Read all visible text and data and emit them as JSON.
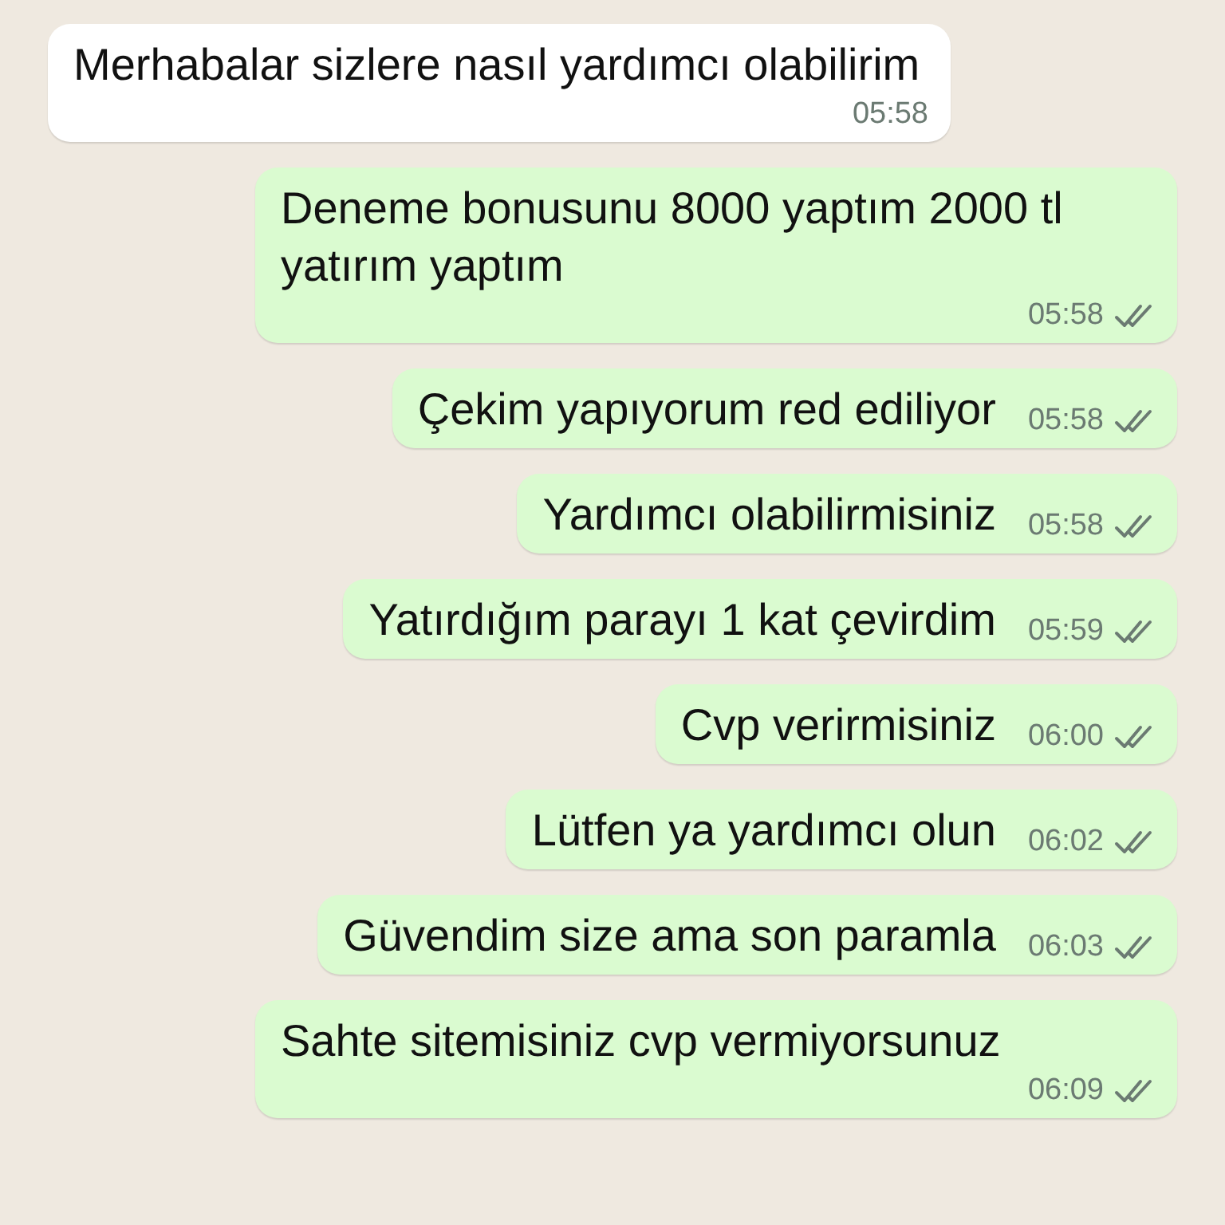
{
  "messages": [
    {
      "kind": "incoming",
      "text": "Merhabalar sizlere nasıl yardımcı olabilirim",
      "time": "05:58"
    },
    {
      "kind": "outgoing",
      "text": "Deneme bonusunu 8000 yaptım 2000 tl yatırım yaptım",
      "time": "05:58",
      "read": false
    },
    {
      "kind": "outgoing",
      "text": "Çekim yapıyorum red ediliyor",
      "time": "05:58",
      "read": false
    },
    {
      "kind": "outgoing",
      "text": "Yardımcı olabilirmisiniz",
      "time": "05:58",
      "read": false
    },
    {
      "kind": "outgoing",
      "text": "Yatırdığım parayı 1 kat çevirdim",
      "time": "05:59",
      "read": false
    },
    {
      "kind": "outgoing",
      "text": "Cvp verirmisiniz",
      "time": "06:00",
      "read": false
    },
    {
      "kind": "outgoing",
      "text": "Lütfen ya yardımcı olun",
      "time": "06:02",
      "read": false
    },
    {
      "kind": "outgoing",
      "text": "Güvendim size ama son paramla",
      "time": "06:03",
      "read": false
    },
    {
      "kind": "outgoing",
      "text": "Sahte sitemisiniz cvp vermiyorsunuz",
      "time": "06:09",
      "read": false
    }
  ]
}
